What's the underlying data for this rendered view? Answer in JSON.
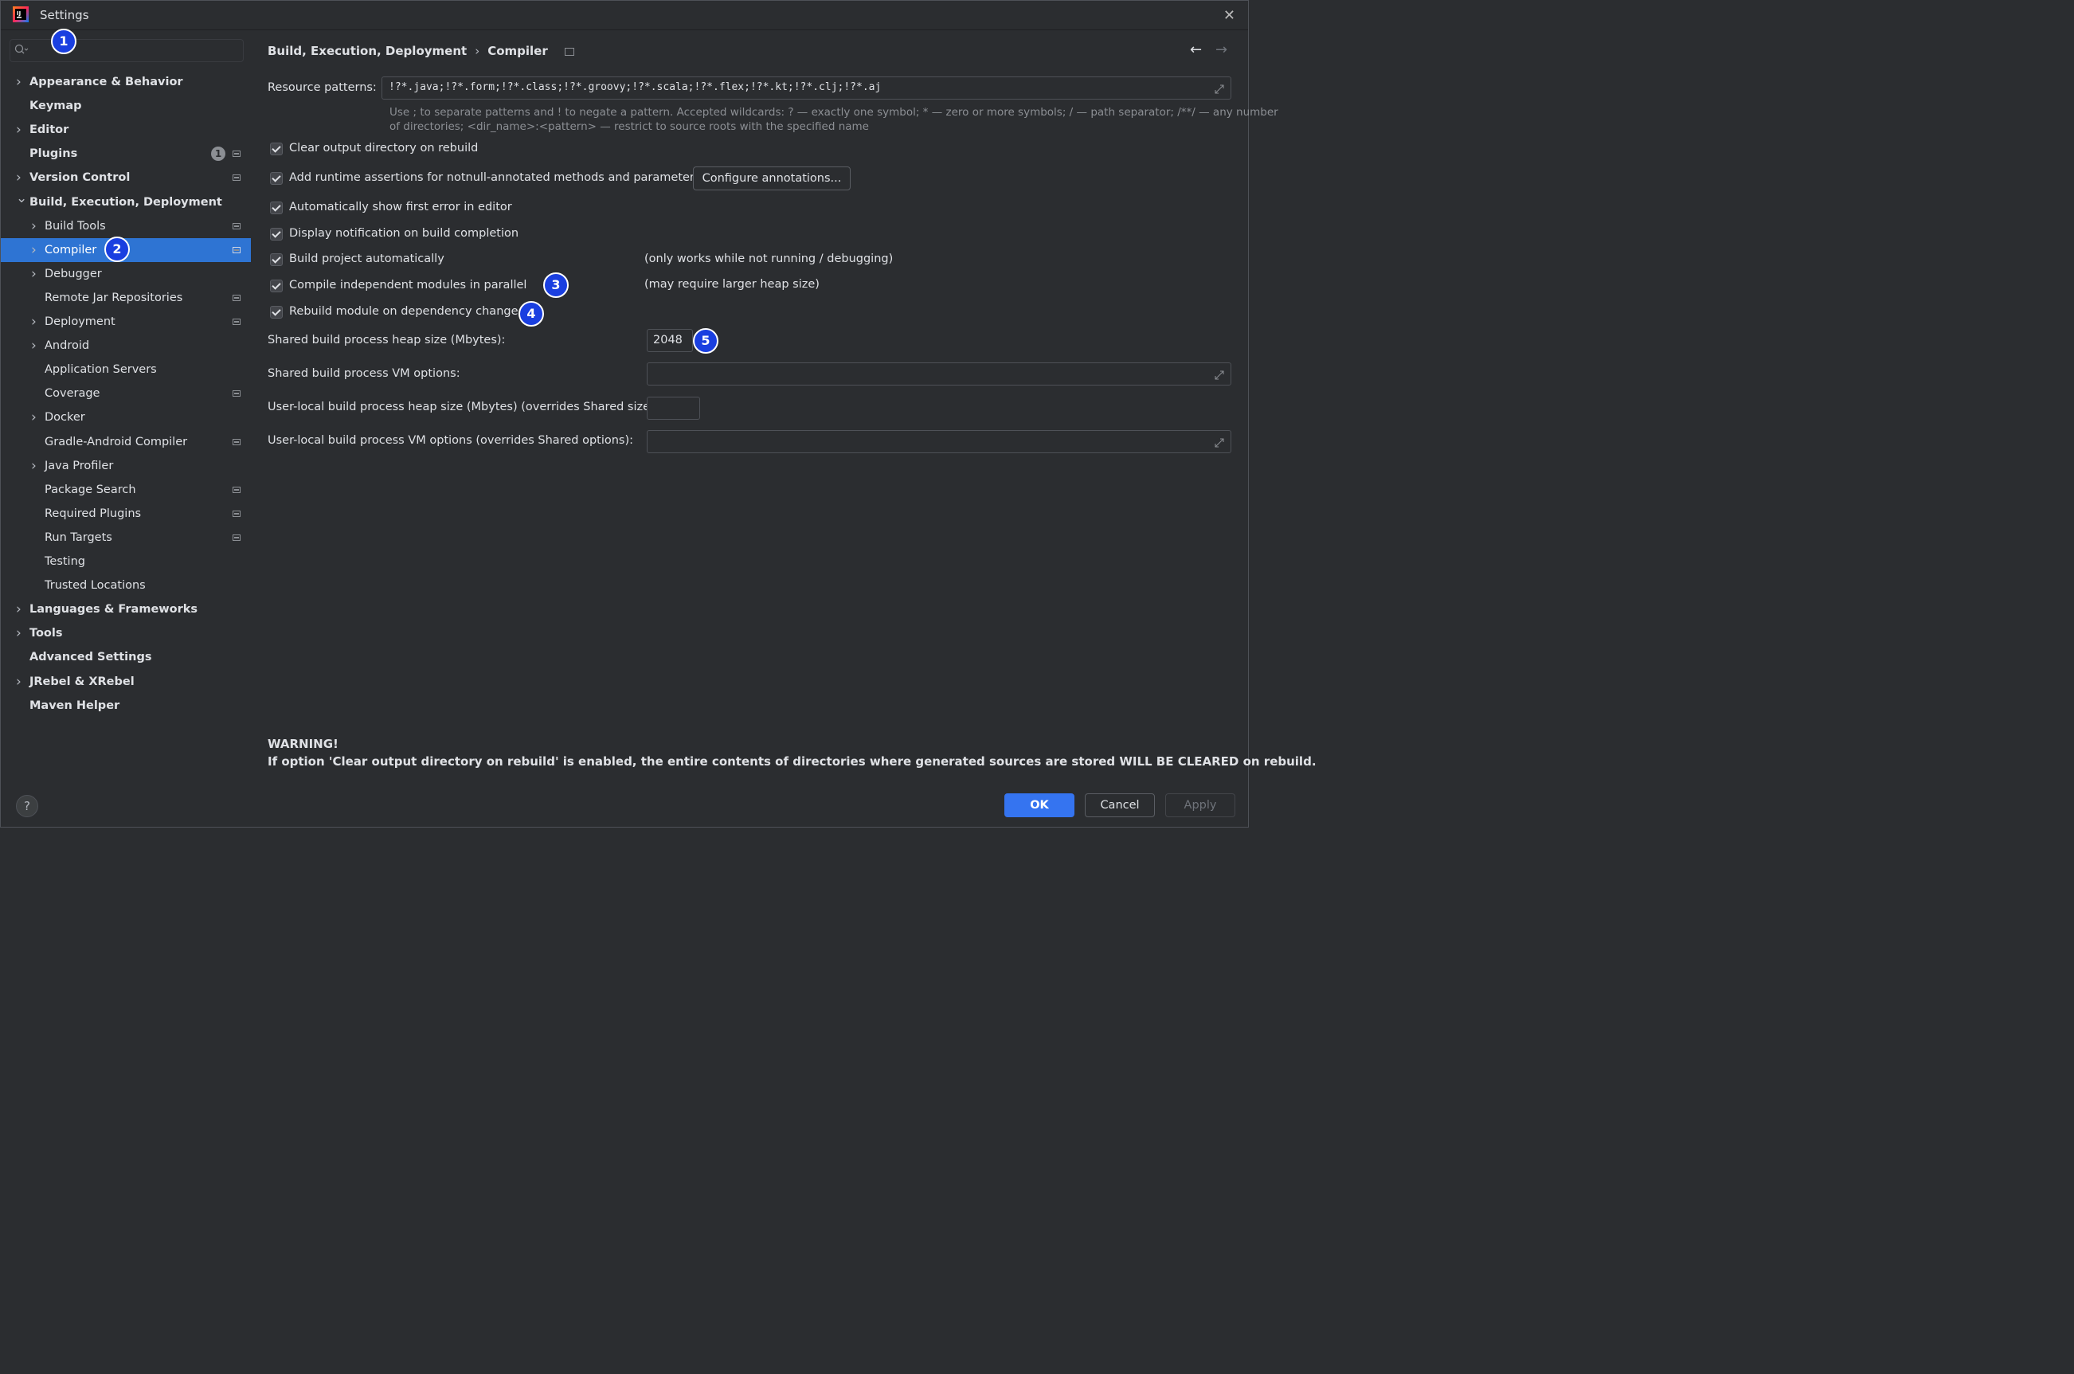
{
  "window": {
    "title": "Settings"
  },
  "search": {
    "placeholder": ""
  },
  "sidebar": {
    "items": [
      {
        "label": "Appearance & Behavior",
        "bold": true,
        "chevron": "right",
        "indent": 0
      },
      {
        "label": "Keymap",
        "bold": true,
        "indent": 0
      },
      {
        "label": "Editor",
        "bold": true,
        "chevron": "right",
        "indent": 0
      },
      {
        "label": "Plugins",
        "bold": true,
        "indent": 0,
        "badge": "1",
        "proj": true
      },
      {
        "label": "Version Control",
        "bold": true,
        "chevron": "right",
        "indent": 0,
        "proj": true
      },
      {
        "label": "Build, Execution, Deployment",
        "bold": true,
        "chevron": "down",
        "indent": 0
      },
      {
        "label": "Build Tools",
        "chevron": "right",
        "indent": 1,
        "proj": true
      },
      {
        "label": "Compiler",
        "chevron": "right",
        "indent": 1,
        "proj": true,
        "selected": true
      },
      {
        "label": "Debugger",
        "chevron": "right",
        "indent": 1
      },
      {
        "label": "Remote Jar Repositories",
        "indent": 1,
        "proj": true
      },
      {
        "label": "Deployment",
        "chevron": "right",
        "indent": 1,
        "proj": true
      },
      {
        "label": "Android",
        "chevron": "right",
        "indent": 1
      },
      {
        "label": "Application Servers",
        "indent": 1
      },
      {
        "label": "Coverage",
        "indent": 1,
        "proj": true
      },
      {
        "label": "Docker",
        "chevron": "right",
        "indent": 1
      },
      {
        "label": "Gradle-Android Compiler",
        "indent": 1,
        "proj": true
      },
      {
        "label": "Java Profiler",
        "chevron": "right",
        "indent": 1
      },
      {
        "label": "Package Search",
        "indent": 1,
        "proj": true
      },
      {
        "label": "Required Plugins",
        "indent": 1,
        "proj": true
      },
      {
        "label": "Run Targets",
        "indent": 1,
        "proj": true
      },
      {
        "label": "Testing",
        "indent": 1
      },
      {
        "label": "Trusted Locations",
        "indent": 1
      },
      {
        "label": "Languages & Frameworks",
        "bold": true,
        "chevron": "right",
        "indent": 0
      },
      {
        "label": "Tools",
        "bold": true,
        "chevron": "right",
        "indent": 0
      },
      {
        "label": "Advanced Settings",
        "bold": true,
        "indent": 0
      },
      {
        "label": "JRebel & XRebel",
        "bold": true,
        "chevron": "right",
        "indent": 0
      },
      {
        "label": "Maven Helper",
        "bold": true,
        "indent": 0
      }
    ]
  },
  "breadcrumb": {
    "parent": "Build, Execution, Deployment",
    "sep": "›",
    "current": "Compiler"
  },
  "compiler": {
    "resource_label": "Resource patterns:",
    "resource_value": "!?*.java;!?*.form;!?*.class;!?*.groovy;!?*.scala;!?*.flex;!?*.kt;!?*.clj;!?*.aj",
    "hint_line1": "Use ; to separate patterns and ! to negate a pattern. Accepted wildcards: ? — exactly one symbol; * — zero or more symbols; / — path separator; /**/ — any number",
    "hint_line2": "of directories; <dir_name>:<pattern> — restrict to source roots with the specified name",
    "checkboxes": [
      {
        "label": "Clear output directory on rebuild",
        "checked": true
      },
      {
        "label": "Add runtime assertions for notnull-annotated methods and parameters",
        "checked": true
      },
      {
        "label": "Automatically show first error in editor",
        "checked": true
      },
      {
        "label": "Display notification on build completion",
        "checked": true
      },
      {
        "label": "Build project automatically",
        "checked": true
      },
      {
        "label": "Compile independent modules in parallel",
        "checked": true
      },
      {
        "label": "Rebuild module on dependency change",
        "checked": true
      }
    ],
    "configure_button": "Configure annotations...",
    "note_build_auto": "(only works while not running / debugging)",
    "note_parallel": "(may require larger heap size)",
    "heap_label": "Shared build process heap size (Mbytes):",
    "heap_value": "2048",
    "vm_label": "Shared build process VM options:",
    "vm_value": "",
    "user_heap_label": "User-local build process heap size (Mbytes) (overrides Shared size):",
    "user_heap_value": "",
    "user_vm_label": "User-local build process VM options (overrides Shared options):",
    "user_vm_value": "",
    "warning_title": "WARNING!",
    "warning_text": "If option 'Clear output directory on rebuild' is enabled, the entire contents of directories where generated sources are stored WILL BE CLEARED on rebuild."
  },
  "footer": {
    "help": "?",
    "ok": "OK",
    "cancel": "Cancel",
    "apply": "Apply"
  },
  "annotations": [
    "1",
    "2",
    "3",
    "4",
    "5"
  ],
  "colors": {
    "selection": "#2e74d3",
    "primary_button": "#3574f0",
    "annotation": "#1a3fe0",
    "background": "#2b2d30"
  }
}
